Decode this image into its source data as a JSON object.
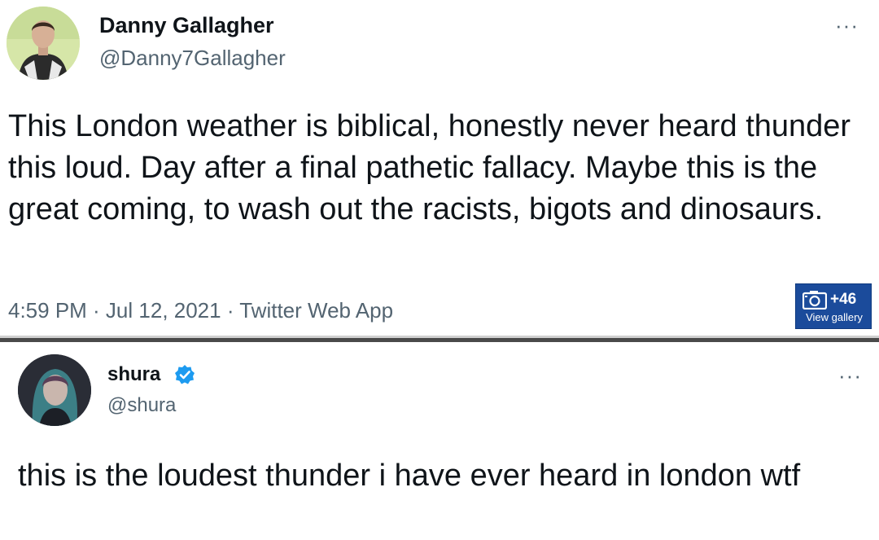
{
  "tweets": [
    {
      "author_name": "Danny Gallagher",
      "author_handle": "@Danny7Gallagher",
      "more_label": "···",
      "text": "This London weather is biblical, honestly never heard thunder this loud. Day after a final pathetic fallacy. Maybe this is the great coming, to wash out the racists, bigots and dinosaurs.",
      "meta": "4:59 PM · Jul 12, 2021 · Twitter Web App",
      "avatar_icon": "avatar-man-icon"
    },
    {
      "author_name": "shura",
      "author_handle": "@shura",
      "verified": true,
      "verified_color": "#1d9bf0",
      "more_label": "···",
      "text": "this is the loudest thunder i have ever heard in london wtf",
      "avatar_icon": "avatar-woman-icon"
    }
  ],
  "gallery": {
    "count": "+46",
    "label": "View gallery",
    "icon": "camera-icon",
    "color": "#1b4b9b"
  }
}
